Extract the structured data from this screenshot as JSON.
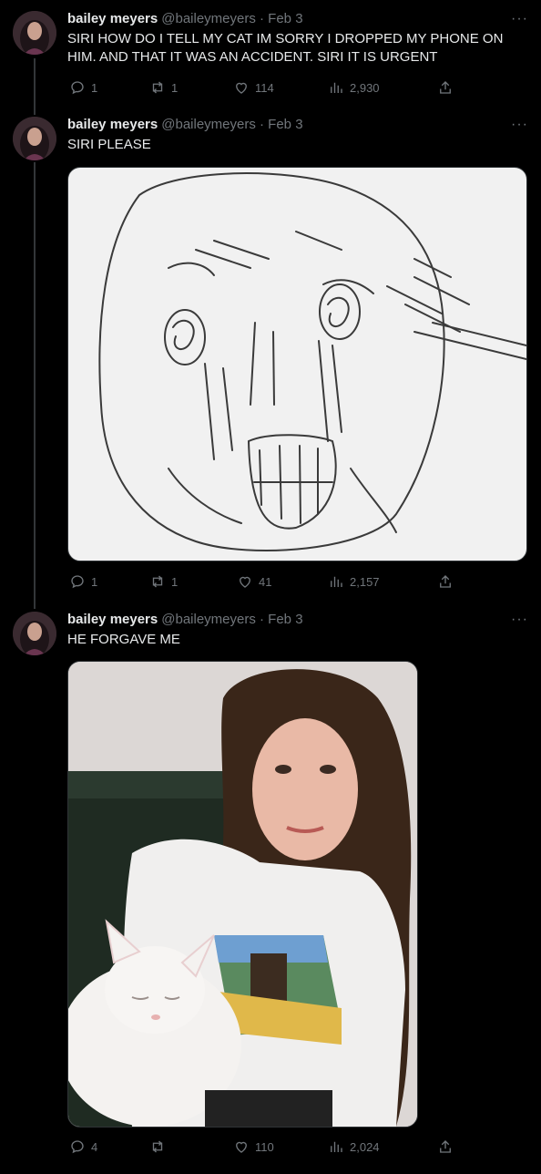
{
  "tweets": [
    {
      "name": "bailey meyers",
      "meta": "@baileymeyers · Feb 3",
      "text": "SIRI HOW DO I TELL MY CAT IM SORRY I DROPPED MY PHONE ON HIM. AND THAT IT WAS AN ACCIDENT. SIRI IT IS URGENT",
      "replies": "1",
      "retweets": "1",
      "likes": "114",
      "views": "2,930"
    },
    {
      "name": "bailey meyers",
      "meta": "@baileymeyers · Feb 3",
      "text": "SIRI PLEASE",
      "media": "crying-face-drawing",
      "replies": "1",
      "retweets": "1",
      "likes": "41",
      "views": "2,157"
    },
    {
      "name": "bailey meyers",
      "meta": "@baileymeyers · Feb 3",
      "text": "HE FORGAVE ME",
      "media": "photo-woman-with-white-cat",
      "replies": "4",
      "retweets": "",
      "likes": "110",
      "views": "2,024"
    }
  ],
  "more_glyph": "···",
  "colors": {
    "background": "#000000",
    "text": "#e7e9ea",
    "muted": "#71767b",
    "thread": "#333639"
  }
}
